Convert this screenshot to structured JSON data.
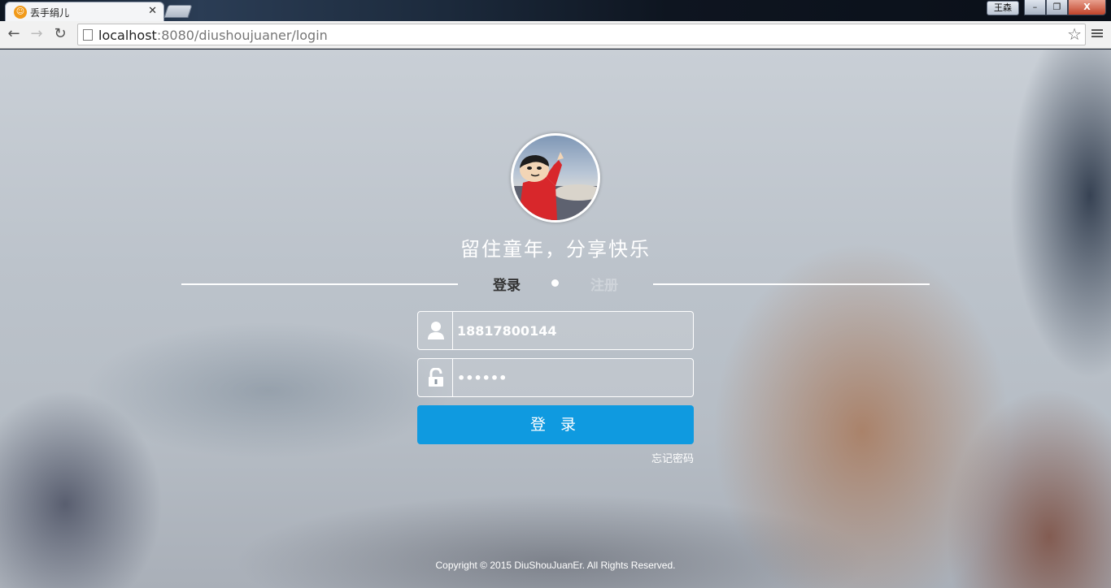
{
  "browser": {
    "tab_title": "丢手绢儿",
    "favicon_glyph": "☺",
    "tab_close_glyph": "✕",
    "user_badge": "王森",
    "win_minimize": "–",
    "win_maximize": "❐",
    "win_close": "X",
    "back_glyph": "←",
    "forward_glyph": "→",
    "reload_glyph": "↻",
    "url_host": "localhost",
    "url_rest": ":8080/diushoujuaner/login",
    "star_glyph": "☆"
  },
  "page": {
    "slogan": "留住童年，分享快乐",
    "tabs": {
      "login": "登录",
      "register": "注册"
    },
    "username_value": "18817800144",
    "password_value": "••••••",
    "login_button": "登 录",
    "forgot_password": "忘记密码",
    "copyright": "Copyright © 2015 DiuShouJuanEr. All Rights Reserved.",
    "accent_color": "#0f9ae0"
  }
}
